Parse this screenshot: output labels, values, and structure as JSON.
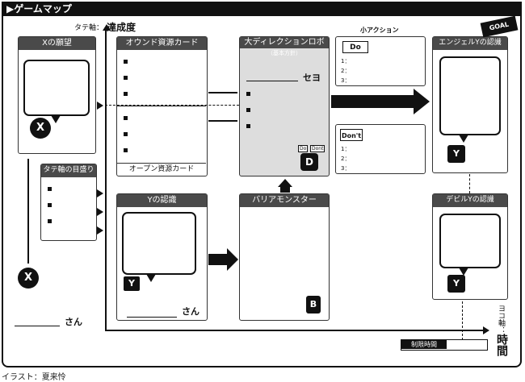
{
  "title": "▶ゲームマップ",
  "axis": {
    "vertical_prefix": "タテ軸：",
    "vertical_label": "達成度",
    "horizontal_label_top": "ヨコ軸：",
    "horizontal_label_main": "時間",
    "time_limit_label": "制限時間"
  },
  "x_desire": {
    "header": "Xの願望"
  },
  "y_axis_scale": {
    "header": "タテ軸の目盛り"
  },
  "x_person": {
    "glyph": "X",
    "suffix": "さん"
  },
  "owned_cards": {
    "header": "オウンド資源カード",
    "footer": "オープン資源カード"
  },
  "direction_robot": {
    "header": "大ディレクションロボ",
    "subheader": "（基本方針）",
    "robot_suffix": "セヨ"
  },
  "y_recognition": {
    "header": "Yの認識",
    "suffix": "さん"
  },
  "barrier_monster": {
    "header": "バリアモンスター",
    "glyph": "B"
  },
  "small_action": {
    "header": "小アクション",
    "do_label": "Do",
    "dont_label": "Don't",
    "items": [
      "1：",
      "2：",
      "3："
    ]
  },
  "angel": {
    "header": "エンジェルYの認識",
    "glyph": "Y"
  },
  "devil": {
    "header": "デビルYの認識",
    "glyph": "Y"
  },
  "goal_badge": "GOAL",
  "robot_labels": {
    "do": "Do",
    "dont": "Dont",
    "glyph": "D"
  },
  "credit": "イラスト：夏来怜"
}
